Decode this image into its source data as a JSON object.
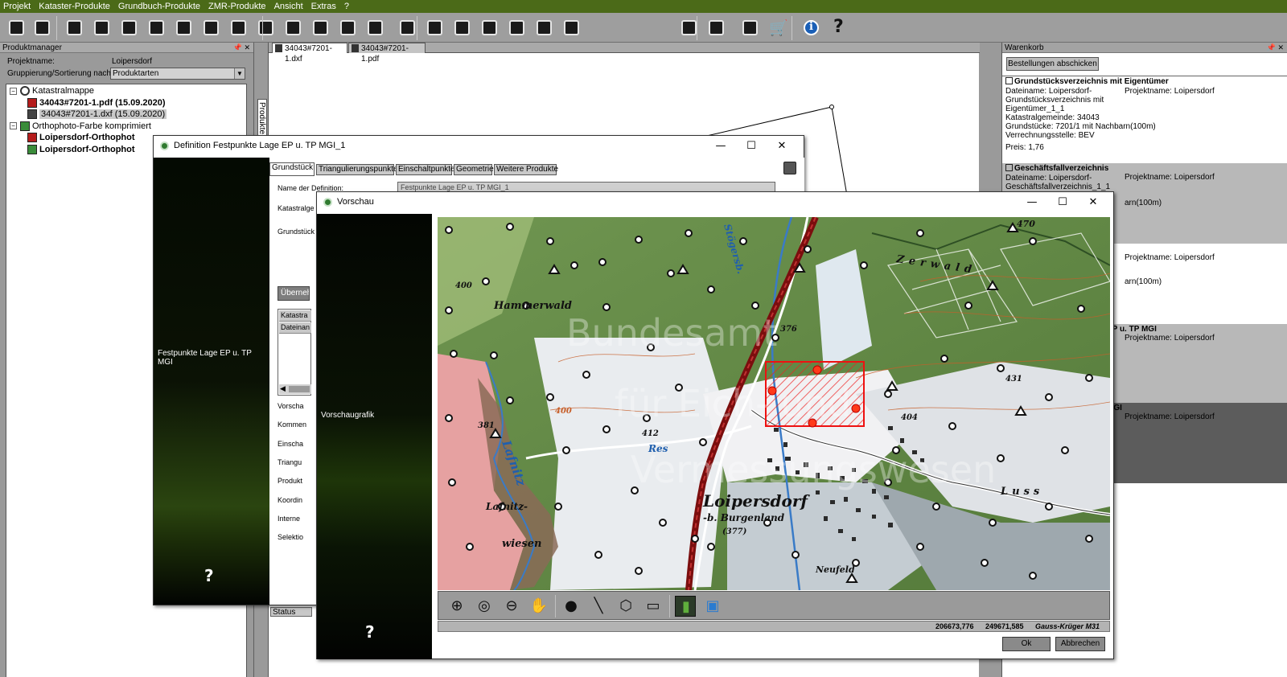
{
  "menu": [
    "Projekt",
    "Kataster-Produkte",
    "Grundbuch-Produkte",
    "ZMR-Produkte",
    "Ansicht",
    "Extras",
    "?"
  ],
  "toolbar_icons": [
    "ruler-icon",
    "book-icon",
    "parcel-icon",
    "document-search-icon",
    "document-edit-icon",
    "ep-icon",
    "gp-icon",
    "mp-icon",
    "tp-icon",
    "list-icon",
    "map-icon",
    "report-icon",
    "grid-icon",
    "print-icon",
    "register-icon",
    "camera-icon",
    "search-doc-icon",
    "certificate-icon",
    "house-icon",
    "owner-icon",
    "person-search-icon",
    "export-icon",
    "tool-icon",
    "checklist-icon",
    "cart-icon",
    "info-icon",
    "help-icon"
  ],
  "product_manager": {
    "title": "Produktmanager",
    "project_label": "Projektname:",
    "project_value": "Loipersdorf",
    "grouping_label": "Gruppierung/Sortierung nach:",
    "grouping_value": "Produktarten",
    "side_tab": "Produkte",
    "tree": [
      {
        "label": "Katastralmappe",
        "level": 0,
        "bold": false,
        "expander": "−",
        "icon": "layer"
      },
      {
        "label": "34043#7201-1.pdf (15.09.2020)",
        "level": 1,
        "bold": true,
        "icon": "pdf"
      },
      {
        "label": "34043#7201-1.dxf (15.09.2020)",
        "level": 1,
        "bold": false,
        "selected": true,
        "icon": "dxf"
      },
      {
        "label": "Orthophoto-Farbe komprimiert",
        "level": 0,
        "bold": false,
        "expander": "−",
        "icon": "photo"
      },
      {
        "label": "Loipersdorf-Orthophot",
        "level": 1,
        "bold": true,
        "icon": "pdf"
      },
      {
        "label": "Loipersdorf-Orthophot",
        "level": 1,
        "bold": true,
        "icon": "photo"
      }
    ]
  },
  "doc_tabs": [
    "34043#7201-1.dxf",
    "34043#7201-1.pdf"
  ],
  "status_label": "Status",
  "warenkorb": {
    "title": "Warenkorb",
    "order_button": "Bestellungen abschicken",
    "items": [
      {
        "title": "Grundstücksverzeichnis mit Eigentümer",
        "lines": [
          "Dateiname: Loipersdorf-",
          "Grundstücksverzeichnis mit",
          "Eigentümer_1_1",
          "Katastralgemeinde: 34043",
          "Grundstücke: 7201/1 mit Nachbarn(100m)",
          "Verrechnungsstelle: BEV",
          "Preis: 1,76"
        ],
        "project": "Projektname: Loipersdorf",
        "bg": "#ffffff"
      },
      {
        "title": "Geschäftsfallverzeichnis",
        "lines": [
          "Dateiname: Loipersdorf-",
          "Geschäftsfallverzeichnis_1_1"
        ],
        "extra": "arn(100m)",
        "project": "Projektname: Loipersdorf",
        "bg": "#b8b8b8"
      },
      {
        "title": "",
        "lines": [],
        "extra": "arn(100m)",
        "project": "Projektname: Loipersdorf",
        "bg": "#ffffff"
      },
      {
        "title": "EP u. TP MGI",
        "lines": [],
        "project": "Projektname: Loipersdorf",
        "bg": "#b8b8b8"
      },
      {
        "title": "MGI",
        "lines": [],
        "project": "Projektname: Loipersdorf",
        "bg": "#5c5c5c"
      }
    ]
  },
  "definition_dialog": {
    "title": "Definition Festpunkte Lage EP u. TP MGI_1",
    "tabs": [
      "Grundstück",
      "Triangulierungspunkte",
      "Einschaltpunkte",
      "Geometrie",
      "Weitere Produkte"
    ],
    "field_labels": [
      "Name der Definition:",
      "Katastralge",
      "Grundstück"
    ],
    "name_value": "Festpunkte Lage EP u. TP MGI_1",
    "apply_button": "Übernehmen",
    "grid_headers": [
      "Katastra",
      "Dateinan"
    ],
    "lower_labels": [
      "Vorscha",
      "Kommen",
      "Einscha",
      "Triangu",
      "Produkt",
      "Koordin",
      "Interne",
      "Selektio"
    ],
    "sidebar_label": "Festpunkte Lage EP u. TP MGI",
    "help": "?"
  },
  "preview_dialog": {
    "title": "Vorschau",
    "sidebar_label": "Vorschaugrafik",
    "help": "?",
    "coords": {
      "x": "206673,776",
      "y": "249671,585",
      "system": "Gauss-Krüger M31"
    },
    "ok_button": "Ok",
    "cancel_button": "Abbrechen",
    "map_tools": [
      "zoom-in-icon",
      "zoom-area-icon",
      "zoom-out-icon",
      "pan-hand-icon",
      "point-icon",
      "line-icon",
      "polygon-icon",
      "rectangle-icon",
      "map-layer-icon",
      "image-layer-icon"
    ],
    "map_labels": {
      "hammerwald": "Hammerwald",
      "zerwald": "Zerwald",
      "loipersdorf": "Loipersdorf",
      "burgenland": "-b. Burgenland",
      "neufeld": "Neufeld",
      "lafnitz": "Lafnitz",
      "lafnitz_wiesen": "Lafnitz-",
      "wiesen": "wiesen",
      "stogersbach": "Stögersb.",
      "res": "Res",
      "luss": "Luss",
      "elev_400a": "400",
      "elev_400b": "400",
      "elev_470": "470",
      "elev_376": "376",
      "elev_412": "412",
      "elev_381": "381",
      "elev_404": "404",
      "elev_431": "431",
      "elev_377": "(377)"
    },
    "watermark": [
      "Bundesamt",
      "für Eich- und",
      "Vermessungswesen"
    ]
  }
}
